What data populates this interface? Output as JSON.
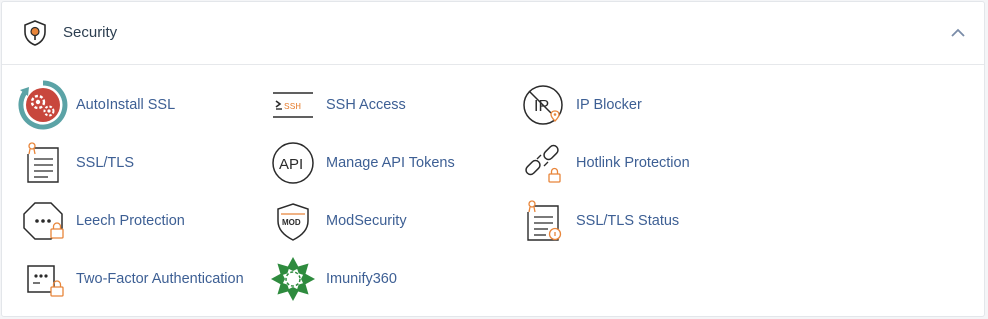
{
  "section": {
    "title": "Security",
    "header_icon": "shield-lock-icon",
    "collapse_icon": "chevron-up-icon"
  },
  "colors": {
    "link": "#3d5f94",
    "accent_orange": "#e8853a",
    "icon_dark": "#2b2b2b",
    "autoinstall_red": "#c8473d",
    "autoinstall_teal": "#5ba3a6",
    "imunify_green": "#2e8b3e"
  },
  "items": [
    {
      "label": "AutoInstall SSL",
      "icon": "autoinstall-ssl-icon"
    },
    {
      "label": "SSH Access",
      "icon": "ssh-terminal-icon",
      "icon_text": "SSH"
    },
    {
      "label": "IP Blocker",
      "icon": "ip-blocker-icon",
      "icon_text": "IP"
    },
    {
      "label": "SSL/TLS",
      "icon": "certificate-icon"
    },
    {
      "label": "Manage API Tokens",
      "icon": "api-token-icon",
      "icon_text": "API"
    },
    {
      "label": "Hotlink Protection",
      "icon": "broken-link-lock-icon"
    },
    {
      "label": "Leech Protection",
      "icon": "password-lock-icon"
    },
    {
      "label": "ModSecurity",
      "icon": "mod-shield-icon",
      "icon_text": "MOD"
    },
    {
      "label": "SSL/TLS Status",
      "icon": "certificate-status-icon"
    },
    {
      "label": "Two-Factor Authentication",
      "icon": "two-factor-icon"
    },
    {
      "label": "Imunify360",
      "icon": "imunify360-icon"
    }
  ]
}
